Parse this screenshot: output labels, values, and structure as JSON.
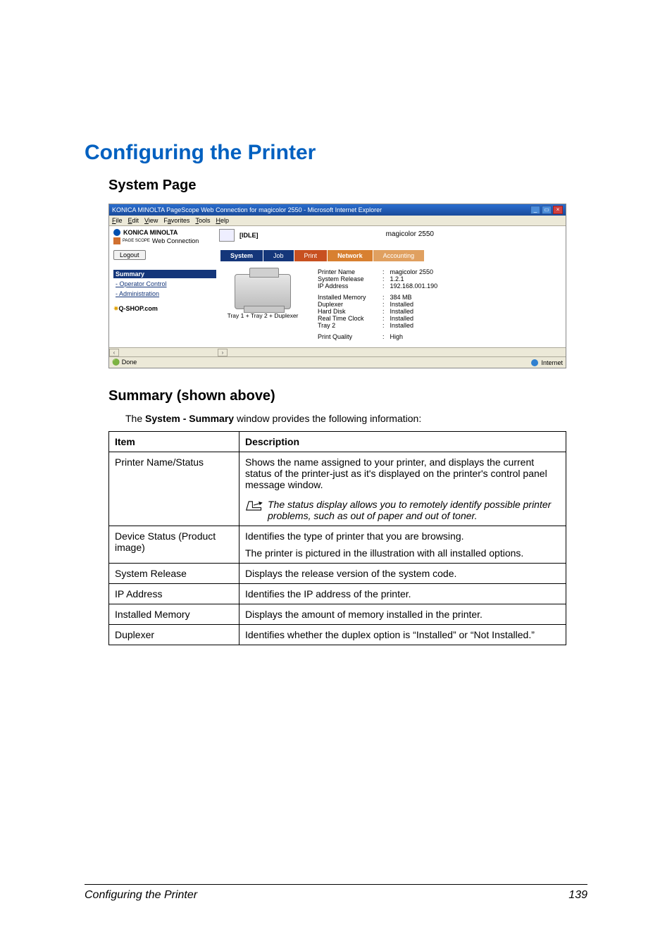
{
  "page": {
    "title": "Configuring the Printer",
    "section1": "System Page",
    "section2": "Summary (shown above)",
    "intro_prefix": "The ",
    "intro_bold": "System - Summary",
    "intro_suffix": " window provides the following information:",
    "footer_left": "Configuring the Printer",
    "footer_right": "139"
  },
  "screenshot": {
    "window_title": "KONICA MINOLTA PageScope Web Connection for magicolor 2550 - Microsoft Internet Explorer",
    "menu": {
      "file": "File",
      "edit": "Edit",
      "view": "View",
      "favorites": "Favorites",
      "tools": "Tools",
      "help": "Help"
    },
    "brand_line1": "KONICA MINOLTA",
    "brand_line2_prefix": "PAGE SCOPE",
    "brand_line2": " Web Connection",
    "status_text": "[IDLE]",
    "printer_title": "magicolor 2550",
    "logout": "Logout",
    "tabs": {
      "system": "System",
      "job": "Job",
      "print": "Print",
      "network": "Network",
      "accounting": "Accounting"
    },
    "nav": {
      "summary": "Summary",
      "operator": "Operator Control",
      "admin": "Administration"
    },
    "qshop": "Q-SHOP.com",
    "illustration_caption": "Tray 1 + Tray 2 + Duplexer",
    "details": {
      "printer_name_label": "Printer Name",
      "printer_name_value": "magicolor 2550",
      "system_release_label": "System Release",
      "system_release_value": "1.2.1",
      "ip_label": "IP Address",
      "ip_value": "192.168.001.190",
      "mem_label": "Installed Memory",
      "mem_value": "384 MB",
      "dup_label": "Duplexer",
      "dup_value": "Installed",
      "hd_label": "Hard Disk",
      "hd_value": "Installed",
      "rtc_label": "Real Time Clock",
      "rtc_value": "Installed",
      "tray2_label": "Tray 2",
      "tray2_value": "Installed",
      "pq_label": "Print Quality",
      "pq_value": "High"
    },
    "status_done": "Done",
    "status_zone": "Internet"
  },
  "table": {
    "header_item": "Item",
    "header_desc": "Description",
    "rows": [
      {
        "item": "Printer Name/Status",
        "desc": "Shows the name assigned to your printer, and displays the current status of the printer-just as it's displayed on the printer's control panel message window.",
        "note": "The status display allows you to remotely identify possible printer problems, such as out of paper and out of toner."
      },
      {
        "item": "Device Status (Product image)",
        "desc_line1": "Identifies the type of printer that you are browsing.",
        "desc_line2": "The printer is pictured in the illustration with all installed options."
      },
      {
        "item": "System Release",
        "desc": "Displays the release version of the system code."
      },
      {
        "item": "IP Address",
        "desc": "Identifies the IP address of the printer."
      },
      {
        "item": "Installed Memory",
        "desc": "Displays the amount of memory installed in the printer."
      },
      {
        "item": "Duplexer",
        "desc": "Identifies whether the duplex option is “Installed” or “Not Installed.”"
      }
    ]
  }
}
